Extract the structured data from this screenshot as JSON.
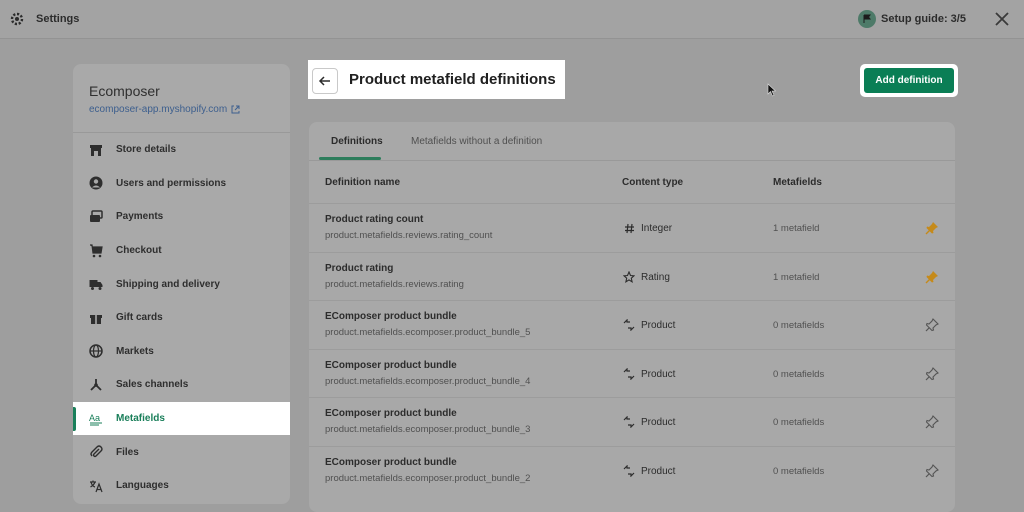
{
  "topbar": {
    "title": "Settings",
    "setup_guide": "Setup guide: 3/5",
    "icons": [
      "gear-icon",
      "flag-icon",
      "close-icon"
    ]
  },
  "sidebar": {
    "store_name": "Ecomposer",
    "store_url": "ecomposer-app.myshopify.com",
    "items": [
      {
        "label": "Store details",
        "icon": "store-icon"
      },
      {
        "label": "Users and permissions",
        "icon": "user-icon"
      },
      {
        "label": "Payments",
        "icon": "payments-icon"
      },
      {
        "label": "Checkout",
        "icon": "cart-icon"
      },
      {
        "label": "Shipping and delivery",
        "icon": "truck-icon"
      },
      {
        "label": "Gift cards",
        "icon": "gift-icon"
      },
      {
        "label": "Markets",
        "icon": "globe-icon"
      },
      {
        "label": "Sales channels",
        "icon": "channels-icon"
      },
      {
        "label": "Metafields",
        "icon": "metafields-icon",
        "active": true
      },
      {
        "label": "Files",
        "icon": "paperclip-icon"
      },
      {
        "label": "Languages",
        "icon": "translate-icon"
      }
    ]
  },
  "page": {
    "title": "Product metafield definitions",
    "add_button": "Add definition"
  },
  "tabs": [
    "Definitions",
    "Metafields without a definition"
  ],
  "table": {
    "headers": {
      "name": "Definition name",
      "type": "Content type",
      "count": "Metafields"
    },
    "rows": [
      {
        "name": "Product rating count",
        "key": "product.metafields.reviews.rating_count",
        "type": "Integer",
        "type_icon": "hash-icon",
        "count": "1 metafield",
        "pinned": true
      },
      {
        "name": "Product rating",
        "key": "product.metafields.reviews.rating",
        "type": "Rating",
        "type_icon": "star-icon",
        "count": "1 metafield",
        "pinned": true
      },
      {
        "name": "EComposer product bundle",
        "key": "product.metafields.ecomposer.product_bundle_5",
        "type": "Product",
        "type_icon": "product-icon",
        "count": "0 metafields",
        "pinned": false
      },
      {
        "name": "EComposer product bundle",
        "key": "product.metafields.ecomposer.product_bundle_4",
        "type": "Product",
        "type_icon": "product-icon",
        "count": "0 metafields",
        "pinned": false
      },
      {
        "name": "EComposer product bundle",
        "key": "product.metafields.ecomposer.product_bundle_3",
        "type": "Product",
        "type_icon": "product-icon",
        "count": "0 metafields",
        "pinned": false
      },
      {
        "name": "EComposer product bundle",
        "key": "product.metafields.ecomposer.product_bundle_2",
        "type": "Product",
        "type_icon": "product-icon",
        "count": "0 metafields",
        "pinned": false
      }
    ]
  },
  "colors": {
    "accent": "#0a7e55",
    "pinned": "#c58a1a",
    "unpinned": "#555555"
  }
}
